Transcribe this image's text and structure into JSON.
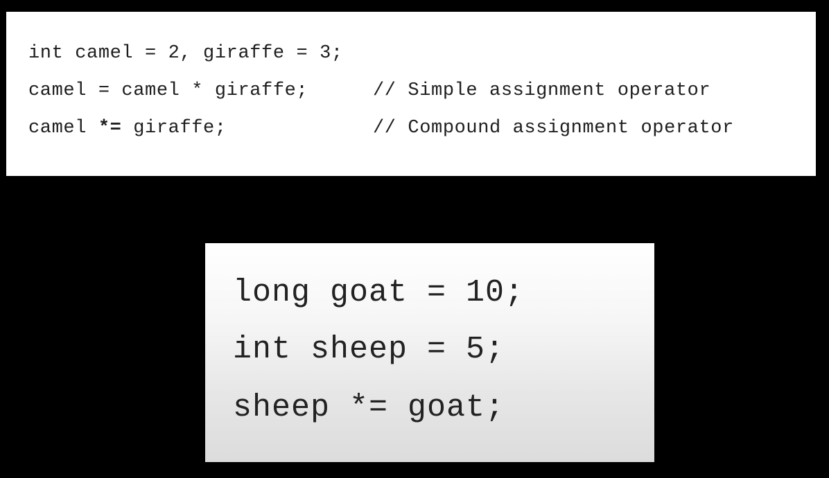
{
  "top_panel": {
    "lines": [
      {
        "code": "int camel = 2, giraffe = 3;",
        "comment": ""
      },
      {
        "code": "camel = camel * giraffe;",
        "comment": "// Simple assignment operator"
      },
      {
        "code_before": "camel ",
        "code_op": "*=",
        "code_after": " giraffe;",
        "comment": "// Compound assignment operator"
      }
    ]
  },
  "bottom_panel": {
    "lines": [
      "long goat = 10;",
      "int sheep = 5;",
      "sheep *= goat;"
    ]
  }
}
